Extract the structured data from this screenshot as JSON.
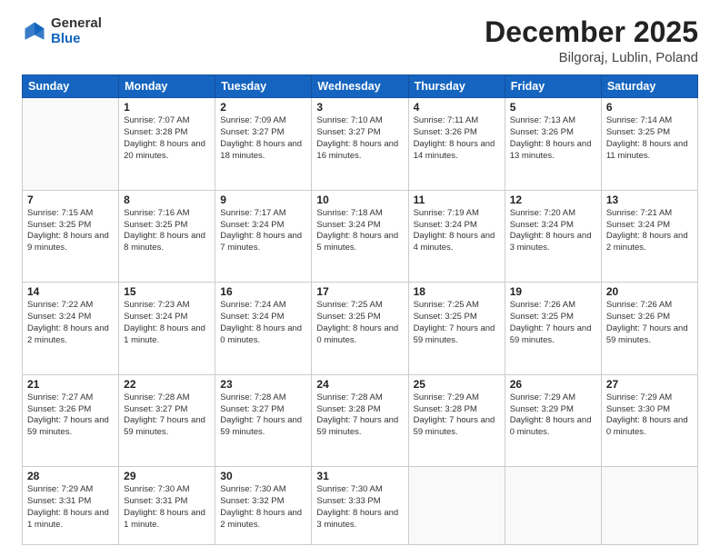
{
  "header": {
    "logo": {
      "general": "General",
      "blue": "Blue"
    },
    "title": "December 2025",
    "location": "Bilgoraj, Lublin, Poland"
  },
  "calendar": {
    "weekdays": [
      "Sunday",
      "Monday",
      "Tuesday",
      "Wednesday",
      "Thursday",
      "Friday",
      "Saturday"
    ],
    "weeks": [
      [
        {
          "day": "",
          "info": ""
        },
        {
          "day": "1",
          "info": "Sunrise: 7:07 AM\nSunset: 3:28 PM\nDaylight: 8 hours\nand 20 minutes."
        },
        {
          "day": "2",
          "info": "Sunrise: 7:09 AM\nSunset: 3:27 PM\nDaylight: 8 hours\nand 18 minutes."
        },
        {
          "day": "3",
          "info": "Sunrise: 7:10 AM\nSunset: 3:27 PM\nDaylight: 8 hours\nand 16 minutes."
        },
        {
          "day": "4",
          "info": "Sunrise: 7:11 AM\nSunset: 3:26 PM\nDaylight: 8 hours\nand 14 minutes."
        },
        {
          "day": "5",
          "info": "Sunrise: 7:13 AM\nSunset: 3:26 PM\nDaylight: 8 hours\nand 13 minutes."
        },
        {
          "day": "6",
          "info": "Sunrise: 7:14 AM\nSunset: 3:25 PM\nDaylight: 8 hours\nand 11 minutes."
        }
      ],
      [
        {
          "day": "7",
          "info": "Sunrise: 7:15 AM\nSunset: 3:25 PM\nDaylight: 8 hours\nand 9 minutes."
        },
        {
          "day": "8",
          "info": "Sunrise: 7:16 AM\nSunset: 3:25 PM\nDaylight: 8 hours\nand 8 minutes."
        },
        {
          "day": "9",
          "info": "Sunrise: 7:17 AM\nSunset: 3:24 PM\nDaylight: 8 hours\nand 7 minutes."
        },
        {
          "day": "10",
          "info": "Sunrise: 7:18 AM\nSunset: 3:24 PM\nDaylight: 8 hours\nand 5 minutes."
        },
        {
          "day": "11",
          "info": "Sunrise: 7:19 AM\nSunset: 3:24 PM\nDaylight: 8 hours\nand 4 minutes."
        },
        {
          "day": "12",
          "info": "Sunrise: 7:20 AM\nSunset: 3:24 PM\nDaylight: 8 hours\nand 3 minutes."
        },
        {
          "day": "13",
          "info": "Sunrise: 7:21 AM\nSunset: 3:24 PM\nDaylight: 8 hours\nand 2 minutes."
        }
      ],
      [
        {
          "day": "14",
          "info": "Sunrise: 7:22 AM\nSunset: 3:24 PM\nDaylight: 8 hours\nand 2 minutes."
        },
        {
          "day": "15",
          "info": "Sunrise: 7:23 AM\nSunset: 3:24 PM\nDaylight: 8 hours\nand 1 minute."
        },
        {
          "day": "16",
          "info": "Sunrise: 7:24 AM\nSunset: 3:24 PM\nDaylight: 8 hours\nand 0 minutes."
        },
        {
          "day": "17",
          "info": "Sunrise: 7:25 AM\nSunset: 3:25 PM\nDaylight: 8 hours\nand 0 minutes."
        },
        {
          "day": "18",
          "info": "Sunrise: 7:25 AM\nSunset: 3:25 PM\nDaylight: 7 hours\nand 59 minutes."
        },
        {
          "day": "19",
          "info": "Sunrise: 7:26 AM\nSunset: 3:25 PM\nDaylight: 7 hours\nand 59 minutes."
        },
        {
          "day": "20",
          "info": "Sunrise: 7:26 AM\nSunset: 3:26 PM\nDaylight: 7 hours\nand 59 minutes."
        }
      ],
      [
        {
          "day": "21",
          "info": "Sunrise: 7:27 AM\nSunset: 3:26 PM\nDaylight: 7 hours\nand 59 minutes."
        },
        {
          "day": "22",
          "info": "Sunrise: 7:28 AM\nSunset: 3:27 PM\nDaylight: 7 hours\nand 59 minutes."
        },
        {
          "day": "23",
          "info": "Sunrise: 7:28 AM\nSunset: 3:27 PM\nDaylight: 7 hours\nand 59 minutes."
        },
        {
          "day": "24",
          "info": "Sunrise: 7:28 AM\nSunset: 3:28 PM\nDaylight: 7 hours\nand 59 minutes."
        },
        {
          "day": "25",
          "info": "Sunrise: 7:29 AM\nSunset: 3:28 PM\nDaylight: 7 hours\nand 59 minutes."
        },
        {
          "day": "26",
          "info": "Sunrise: 7:29 AM\nSunset: 3:29 PM\nDaylight: 8 hours\nand 0 minutes."
        },
        {
          "day": "27",
          "info": "Sunrise: 7:29 AM\nSunset: 3:30 PM\nDaylight: 8 hours\nand 0 minutes."
        }
      ],
      [
        {
          "day": "28",
          "info": "Sunrise: 7:29 AM\nSunset: 3:31 PM\nDaylight: 8 hours\nand 1 minute."
        },
        {
          "day": "29",
          "info": "Sunrise: 7:30 AM\nSunset: 3:31 PM\nDaylight: 8 hours\nand 1 minute."
        },
        {
          "day": "30",
          "info": "Sunrise: 7:30 AM\nSunset: 3:32 PM\nDaylight: 8 hours\nand 2 minutes."
        },
        {
          "day": "31",
          "info": "Sunrise: 7:30 AM\nSunset: 3:33 PM\nDaylight: 8 hours\nand 3 minutes."
        },
        {
          "day": "",
          "info": ""
        },
        {
          "day": "",
          "info": ""
        },
        {
          "day": "",
          "info": ""
        }
      ]
    ]
  }
}
